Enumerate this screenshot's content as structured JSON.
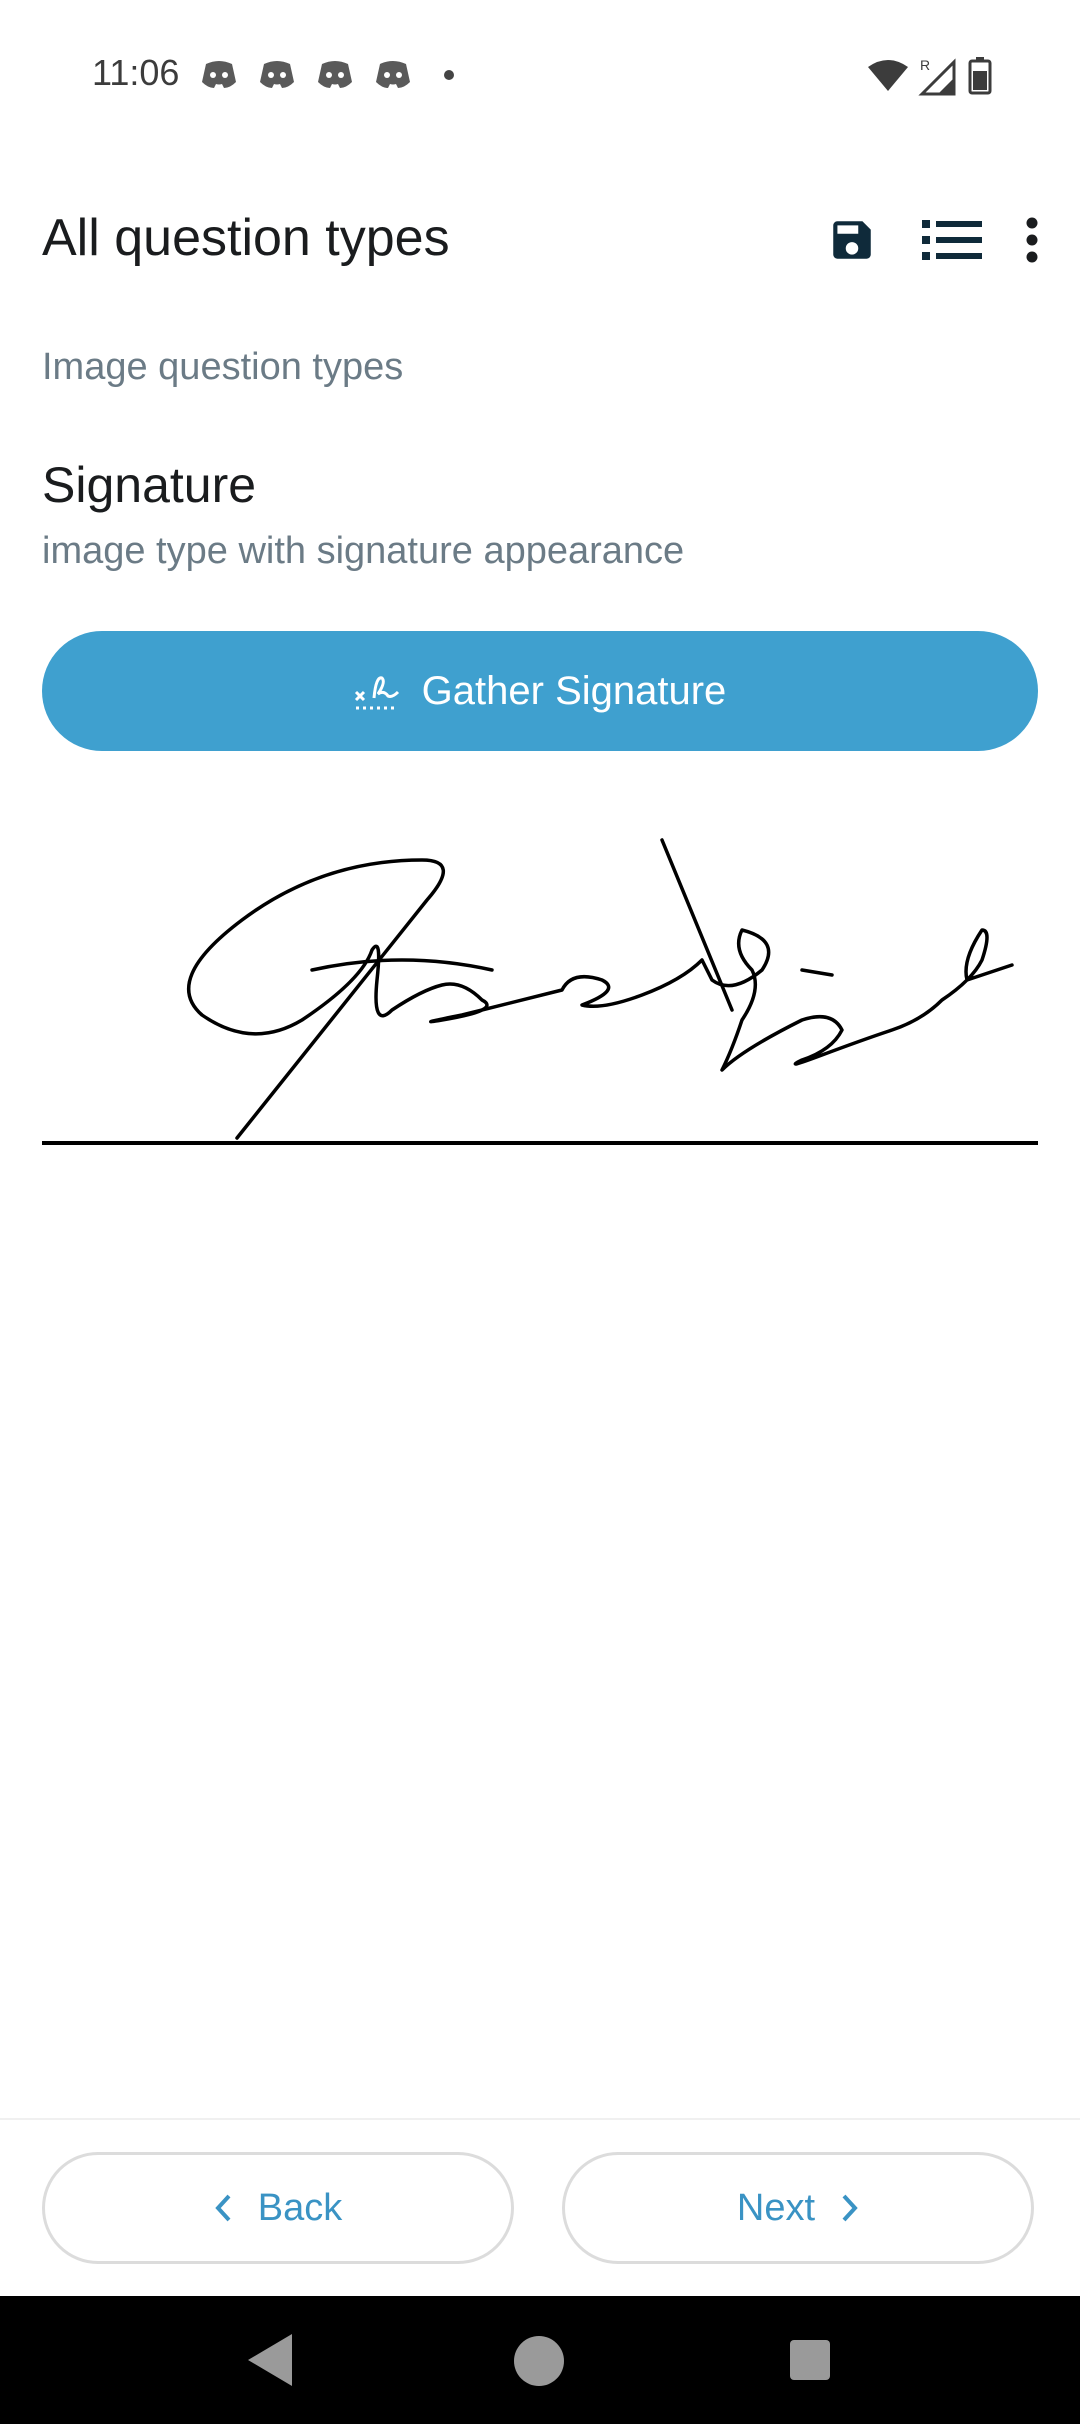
{
  "status_bar": {
    "time": "11:06",
    "app_icons": [
      "discord-icon",
      "discord-icon",
      "discord-icon",
      "discord-icon"
    ],
    "indicators": [
      "wifi-icon",
      "signal-roaming-icon",
      "battery-icon"
    ],
    "roaming_mark": "R"
  },
  "app_bar": {
    "title": "All question types",
    "actions": [
      "save-icon",
      "hierarchy-list-icon",
      "overflow-menu-icon"
    ]
  },
  "form": {
    "group_label": "Image question types",
    "question_title": "Signature",
    "question_hint": "image type with signature appearance",
    "gather_button_label": "Gather Signature"
  },
  "navigation": {
    "back_label": "Back",
    "next_label": "Next"
  },
  "colors": {
    "primary": "#3fa0cf",
    "nav_text": "#3a93c4",
    "hint_text": "#6b7b86",
    "title_text": "#1a1c1e"
  }
}
